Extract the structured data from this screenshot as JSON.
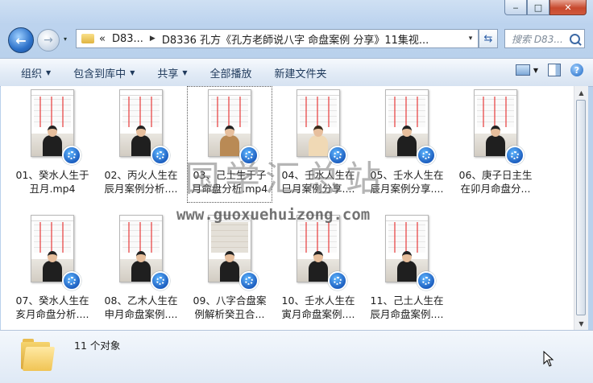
{
  "window": {
    "controls": {
      "minimize": "‒",
      "maximize": "□",
      "close": "✕"
    }
  },
  "nav": {
    "back_glyph": "←",
    "forward_glyph": "→",
    "history_glyph": "▾",
    "breadcrumb": [
      "«",
      "D83...",
      "D8336 孔方《孔方老師说八字 命盘案例 分享》11集视..."
    ],
    "address_dropdown": "▾",
    "refresh_glyph": "⇆",
    "search_placeholder": "搜索 D83..."
  },
  "toolbar": {
    "organize": "组织",
    "include_library": "包含到库中",
    "share": "共享",
    "play_all": "全部播放",
    "new_folder": "新建文件夹",
    "help": "?"
  },
  "files": [
    {
      "name": "01、癸水人生于丑月.mp4",
      "line1": "01、癸水人生于",
      "line2": "丑月.mp4"
    },
    {
      "name": "02、丙火人生在辰月案例分析....",
      "line1": "02、丙火人生在",
      "line2": "辰月案例分析...."
    },
    {
      "name": "03、己土生于子月命盘分析.mp4",
      "line1": "03、己土生于子",
      "line2": "月命盘分析.mp4"
    },
    {
      "name": "04、壬水人生在巳月案例分享....",
      "line1": "04、壬水人生在",
      "line2": "巳月案例分享...."
    },
    {
      "name": "05、壬水人生在辰月案例分享....",
      "line1": "05、壬水人生在",
      "line2": "辰月案例分享...."
    },
    {
      "name": "06、庚子日主生在卯月命盘分...",
      "line1": "06、庚子日主生",
      "line2": "在卯月命盘分..."
    },
    {
      "name": "07、癸水人生在亥月命盘分析....",
      "line1": "07、癸水人生在",
      "line2": "亥月命盘分析...."
    },
    {
      "name": "08、乙木人生在申月命盘案例....",
      "line1": "08、乙木人生在",
      "line2": "申月命盘案例...."
    },
    {
      "name": "09、八字合盘案例解析癸丑合...",
      "line1": "09、八字合盘案",
      "line2": "例解析癸丑合..."
    },
    {
      "name": "10、壬水人生在寅月命盘案例....",
      "line1": "10、壬水人生在",
      "line2": "寅月命盘案例...."
    },
    {
      "name": "11、己土人生在辰月命盘案例....",
      "line1": "11、己土人生在",
      "line2": "辰月命盘案例...."
    }
  ],
  "watermark": {
    "text": "国学汇总站",
    "url": "www.guoxuehuizong.com"
  },
  "status": {
    "count": "11 个对象"
  },
  "scroll": {
    "up": "▲",
    "down": "▼"
  }
}
